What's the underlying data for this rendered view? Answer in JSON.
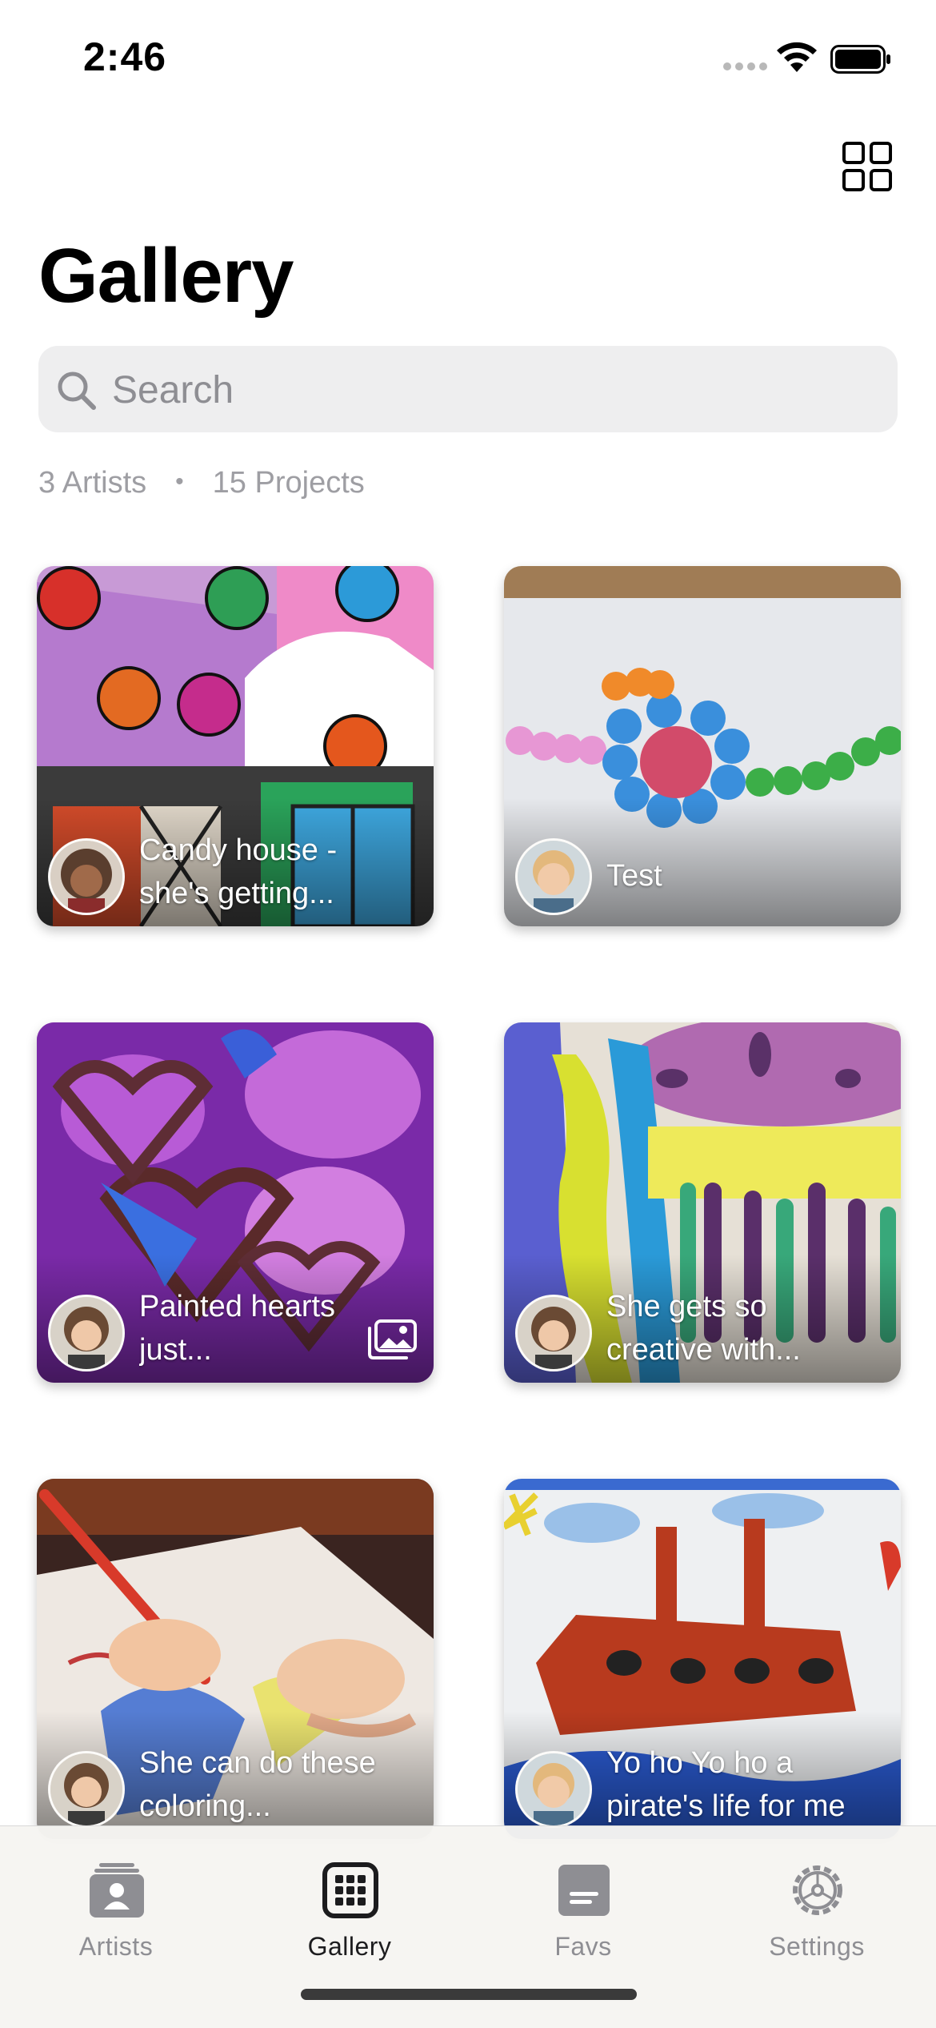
{
  "status_bar": {
    "time": "2:46"
  },
  "header": {
    "title": "Gallery",
    "layout_icon": "grid-icon"
  },
  "search": {
    "placeholder": "Search",
    "value": ""
  },
  "summary": {
    "artists": "3 Artists",
    "separator": "•",
    "projects": "15 Projects"
  },
  "projects": [
    {
      "caption": "Candy house - she's getting...",
      "artist_avatar": "girl-curly-hair",
      "multiple_images": false
    },
    {
      "caption": "Test",
      "artist_avatar": "boy-blond",
      "multiple_images": false
    },
    {
      "caption": "Painted hearts just...",
      "artist_avatar": "girl-pigtails",
      "multiple_images": true
    },
    {
      "caption": "She gets so creative with...",
      "artist_avatar": "girl-pigtails",
      "multiple_images": false
    },
    {
      "caption": "She can do these coloring...",
      "artist_avatar": "girl-pigtails",
      "multiple_images": false
    },
    {
      "caption": "Yo ho Yo ho a pirate's life for me",
      "artist_avatar": "boy-blond",
      "multiple_images": false
    }
  ],
  "tabs": [
    {
      "label": "Artists",
      "icon": "artist-card-icon",
      "active": false
    },
    {
      "label": "Gallery",
      "icon": "gallery-grid-icon",
      "active": true
    },
    {
      "label": "Favs",
      "icon": "favs-icon",
      "active": false
    },
    {
      "label": "Settings",
      "icon": "gear-icon",
      "active": false
    }
  ],
  "colors": {
    "accent": "#1c1c1e",
    "inactive": "#8e8e93",
    "search_bg": "#eeeeef"
  }
}
